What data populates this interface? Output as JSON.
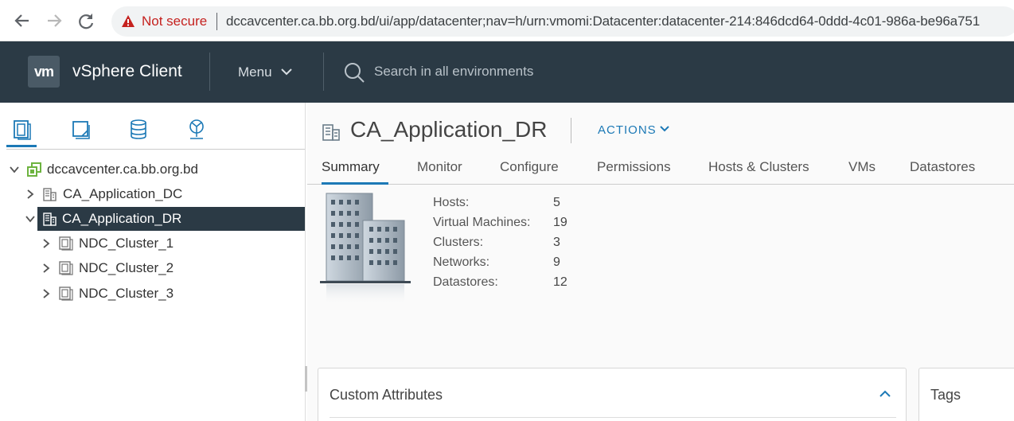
{
  "browser": {
    "security_label": "Not secure",
    "url": "dccavcenter.ca.bb.org.bd/ui/app/datacenter;nav=h/urn:vmomi:Datacenter:datacenter-214:846dcd64-0ddd-4c01-986a-be96a751"
  },
  "header": {
    "logo_text": "vm",
    "app_title": "vSphere Client",
    "menu_label": "Menu",
    "search_placeholder": "Search in all environments"
  },
  "navigator": {
    "tabs": [
      {
        "icon": "hosts-clusters-icon",
        "active": true
      },
      {
        "icon": "vms-templates-icon",
        "active": false
      },
      {
        "icon": "storage-icon",
        "active": false
      },
      {
        "icon": "networking-icon",
        "active": false
      }
    ],
    "tree": [
      {
        "label": "dccavcenter.ca.bb.org.bd",
        "icon": "vcenter-icon",
        "expanded": true,
        "depth": 0
      },
      {
        "label": "CA_Application_DC",
        "icon": "datacenter-icon",
        "expanded": false,
        "depth": 1
      },
      {
        "label": "CA_Application_DR",
        "icon": "datacenter-icon",
        "expanded": true,
        "depth": 1,
        "selected": true
      },
      {
        "label": "NDC_Cluster_1",
        "icon": "cluster-icon",
        "expanded": false,
        "depth": 2
      },
      {
        "label": "NDC_Cluster_2",
        "icon": "cluster-icon",
        "expanded": false,
        "depth": 2
      },
      {
        "label": "NDC_Cluster_3",
        "icon": "cluster-icon",
        "expanded": false,
        "depth": 2
      }
    ]
  },
  "object": {
    "title": "CA_Application_DR",
    "actions_label": "ACTIONS",
    "tabs": [
      "Summary",
      "Monitor",
      "Configure",
      "Permissions",
      "Hosts & Clusters",
      "VMs",
      "Datastores"
    ],
    "active_tab": "Summary",
    "stats": [
      {
        "label": "Hosts:",
        "value": "5"
      },
      {
        "label": "Virtual Machines:",
        "value": "19"
      },
      {
        "label": "Clusters:",
        "value": "3"
      },
      {
        "label": "Networks:",
        "value": "9"
      },
      {
        "label": "Datastores:",
        "value": "12"
      }
    ],
    "cards": [
      {
        "title": "Custom Attributes",
        "expanded": true
      },
      {
        "title": "Tags"
      }
    ]
  },
  "colors": {
    "header_bg": "#2b3a45",
    "accent": "#1c79b6",
    "selected_row_bg": "#2b3a45",
    "warning_red": "#c5221f",
    "vcenter_green": "#6db33f"
  }
}
